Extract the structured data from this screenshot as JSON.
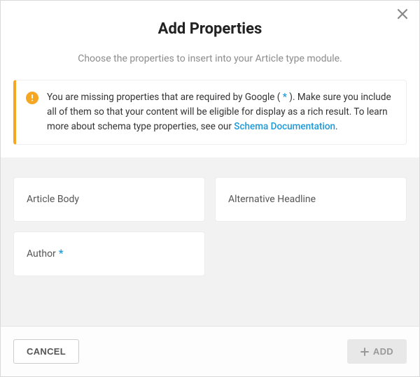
{
  "header": {
    "title": "Add Properties",
    "subtitle": "Choose the properties to insert into your Article type module."
  },
  "warning": {
    "text_1": "You are missing properties that are required by Google ( ",
    "star": "*",
    "text_2": " ). Make sure you include all of them so that your content will be eligible for display as a rich result. To learn more about schema type properties, see our ",
    "link_label": "Schema Documentation",
    "text_3": "."
  },
  "properties": [
    {
      "label": "Article Body",
      "required": false
    },
    {
      "label": "Alternative Headline",
      "required": false
    },
    {
      "label": "Author",
      "required": true
    }
  ],
  "footer": {
    "cancel_label": "CANCEL",
    "add_label": "ADD"
  }
}
